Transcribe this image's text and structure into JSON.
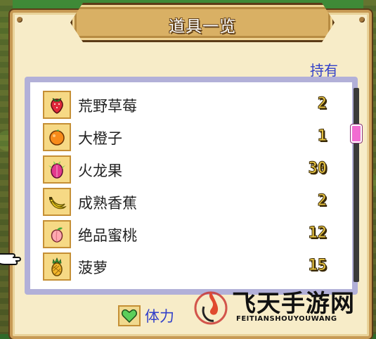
{
  "window": {
    "title": "道具一览"
  },
  "header": {
    "holding_label": "持有"
  },
  "items": [
    {
      "name": "荒野草莓",
      "qty": "2",
      "icon": "strawberry-icon"
    },
    {
      "name": "大橙子",
      "qty": "1",
      "icon": "orange-icon"
    },
    {
      "name": "火龙果",
      "qty": "30",
      "icon": "dragon-fruit-icon"
    },
    {
      "name": "成熟香蕉",
      "qty": "2",
      "icon": "banana-icon"
    },
    {
      "name": "绝品蜜桃",
      "qty": "12",
      "icon": "peach-icon"
    },
    {
      "name": "菠萝",
      "qty": "15",
      "icon": "pineapple-icon"
    }
  ],
  "footer": {
    "stamina_text": "体力",
    "stamina_icon": "green-heart-icon"
  },
  "watermark": {
    "cn": "飞天手游网",
    "en": "FEITIANSHOUYOUWANG"
  },
  "colors": {
    "accent_text": "#3240c9",
    "qty_fill": "#e9c542",
    "scroll_thumb": "#f26cd2"
  }
}
